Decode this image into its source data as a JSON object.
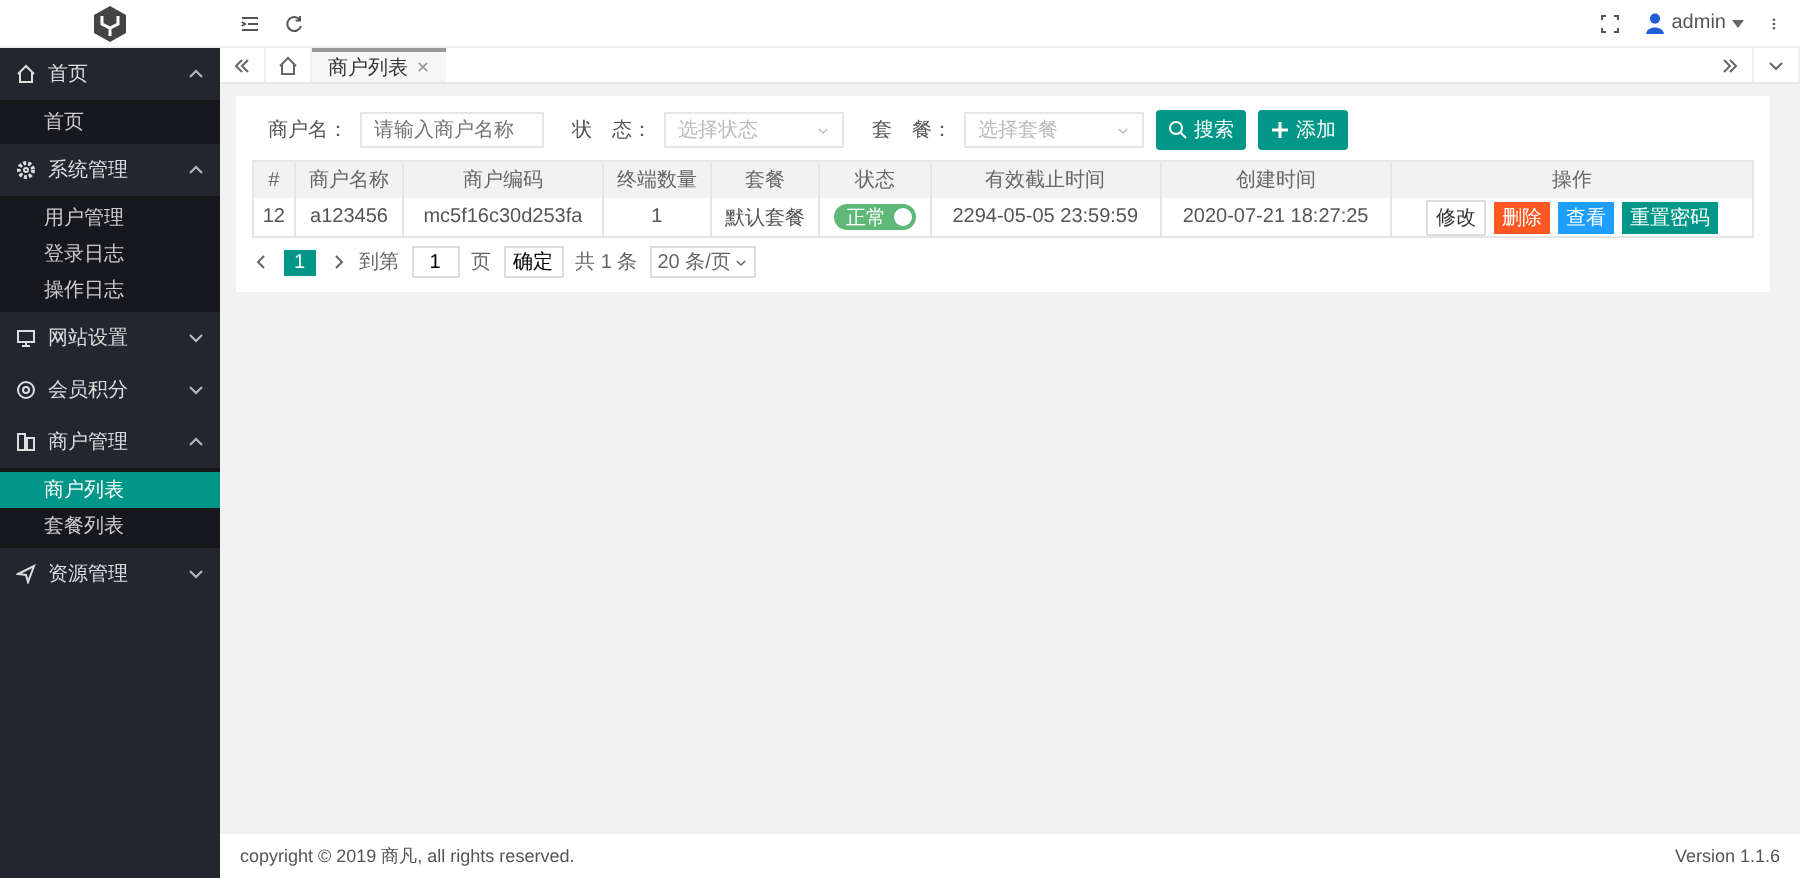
{
  "sidebar": {
    "groups": [
      {
        "label": "首页",
        "expanded": true,
        "children": [
          {
            "label": "首页",
            "selected": false
          }
        ]
      },
      {
        "label": "系统管理",
        "expanded": true,
        "children": [
          {
            "label": "用户管理",
            "selected": false
          },
          {
            "label": "登录日志",
            "selected": false
          },
          {
            "label": "操作日志",
            "selected": false
          }
        ]
      },
      {
        "label": "网站设置",
        "expanded": false
      },
      {
        "label": "会员积分",
        "expanded": false
      },
      {
        "label": "商户管理",
        "expanded": true,
        "children": [
          {
            "label": "商户列表",
            "selected": true
          },
          {
            "label": "套餐列表",
            "selected": false
          }
        ]
      },
      {
        "label": "资源管理",
        "expanded": false
      }
    ]
  },
  "header": {
    "user": "admin"
  },
  "tabs": [
    {
      "label": "商户列表",
      "selected": true
    }
  ],
  "filters": [
    {
      "label": "商户名：",
      "kind": "text",
      "placeholder": "请输入商户名称"
    },
    {
      "label": "状　态：",
      "kind": "select",
      "placeholder": "选择状态"
    },
    {
      "label": "套　餐：",
      "kind": "select",
      "placeholder": "选择套餐"
    }
  ],
  "filter_buttons": [
    {
      "label": "搜索",
      "kind": "search"
    },
    {
      "label": "添加",
      "kind": "add"
    }
  ],
  "table": {
    "columns": [
      "#",
      "商户名称",
      "商户编码",
      "终端数量",
      "套餐",
      "状态",
      "有效截止时间",
      "创建时间",
      "操作"
    ],
    "rows": [
      {
        "cells": [
          "12",
          "a123456",
          "mc5f16c30d253fa",
          "1",
          "默认套餐"
        ],
        "status": {
          "label": "正常",
          "on": true
        },
        "cells_after": [
          "2294-05-05 23:59:59",
          "2020-07-21 18:27:25"
        ],
        "actions": [
          {
            "label": "修改",
            "kind": "default"
          },
          {
            "label": "删除",
            "kind": "danger"
          },
          {
            "label": "查看",
            "kind": "info"
          },
          {
            "label": "重置密码",
            "kind": "teal"
          }
        ]
      }
    ]
  },
  "pagination": {
    "pages": [
      {
        "label": "1",
        "selected": true
      }
    ],
    "goto_prefix": "到第",
    "goto_value": "1",
    "goto_suffix": "页",
    "confirm": "确定",
    "total": "共 1 条",
    "page_size": "20 条/页"
  },
  "footer": {
    "copyright": "copyright © 2019 商凡, all rights reserved.",
    "version": "Version 1.1.6"
  }
}
